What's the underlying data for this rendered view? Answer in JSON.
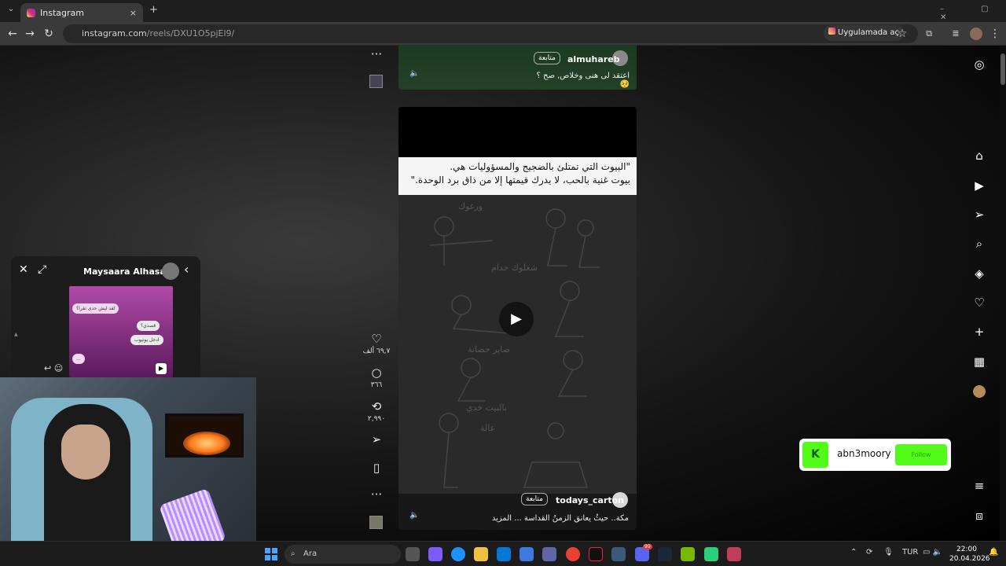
{
  "browser": {
    "tab_title": "Instagram",
    "url_host": "instagram.com",
    "url_path": "/reels/DXU1O5pjEl9/",
    "open_in_app": "Uygulamada aç"
  },
  "reel_top": {
    "username": "almuhareb",
    "follow": "متابعة",
    "caption": "اعتقد لى هنى وخلاص, صح ؟ 🥺"
  },
  "reel_main": {
    "quote_line1": "\"البيوت التي تمتلئ بالضجيج والمسؤوليات هي.",
    "quote_line2": "بيوت غنية بالحب، لا يدرك قيمتها إلا من ذاق برد الوحدة.\"",
    "username": "todays_carton",
    "follow": "متابعة",
    "caption": "مكة.. حيثُ يعانق الزمنُ القداسة ... المزيد",
    "art_labels": [
      "ورغوك",
      "شغلوك خدام",
      "صاير حضانة",
      "بالبيت خدي",
      "عالة"
    ]
  },
  "actions": {
    "likes": "٦٩,٧ ألف",
    "comments": "٣٦٦",
    "reposts": "٢,٩٩٠"
  },
  "chat": {
    "name": "Maysaara Alhasan",
    "bubbles": [
      "لقد ليش حدى تقرا؟",
      "قصدي؟",
      "ادخل يوتيوب",
      "..."
    ]
  },
  "kick": {
    "logo": "K",
    "username": "abn3moory",
    "follow": "Follow"
  },
  "taskbar": {
    "search": "Ara",
    "lang": "TUR",
    "time": "22:00",
    "date": "20.04.2026",
    "badge": "99"
  },
  "icons": {
    "tab_close": "×",
    "new_tab": "+",
    "back": "←",
    "forward": "→",
    "reload": "↻",
    "star": "☆",
    "more": "⋮",
    "play": "▶",
    "mute": "🔈",
    "heart": "♡",
    "comment": "○",
    "repost": "⟲",
    "share": "➢",
    "bookmark": "▯",
    "dots": "···",
    "home": "⌂",
    "search": "⌕",
    "plus": "+",
    "menu": "≡",
    "close": "✕",
    "expand": "⤢",
    "chevron": "‹"
  }
}
